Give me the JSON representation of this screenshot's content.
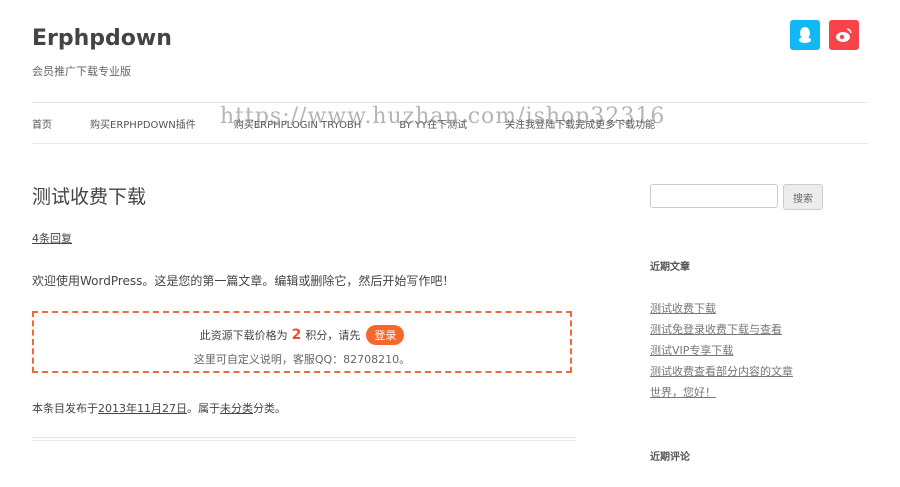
{
  "header": {
    "site_title": "Erphpdown",
    "site_description": "会员推广下载专业版"
  },
  "social": {
    "qq_icon": "qq-penguin-icon",
    "weibo_icon": "weibo-icon",
    "qq_color": "#12b7f5",
    "weibo_color": "#f8434a"
  },
  "nav": {
    "items": [
      "首页",
      "购买ERPHPDOWN插件",
      "购买ERPHPLOGIN TRYOBH",
      "BY YY在下测试",
      "关注我登陆下载完成更多下载功能"
    ]
  },
  "watermark": "https://www.huzhan.com/ishop32316",
  "post": {
    "title": "测试收费下载",
    "comments_link": "4条回复",
    "content": "欢迎使用WordPress。这是您的第一篇文章。编辑或删除它，然后开始写作吧！",
    "erphp": {
      "price_prefix": "此资源下载价格为",
      "price": "2",
      "price_suffix": "积分，请先",
      "login_label": "登录",
      "note": "这里可自定义说明，客服QQ：82708210。"
    },
    "meta": {
      "prefix": "本条目发布于",
      "date": "2013年11月27日",
      "mid": "。属于",
      "category": "未分类",
      "suffix": "分类。"
    }
  },
  "sidebar": {
    "search_placeholder": "",
    "search_button": "搜索",
    "recent_posts_title": "近期文章",
    "recent_posts": [
      "测试收费下载",
      "测试免登录收费下载与查看",
      "测试VIP专享下载",
      "测试收费查看部分内容的文章",
      "世界，您好！"
    ],
    "recent_comments_title": "近期评论"
  }
}
